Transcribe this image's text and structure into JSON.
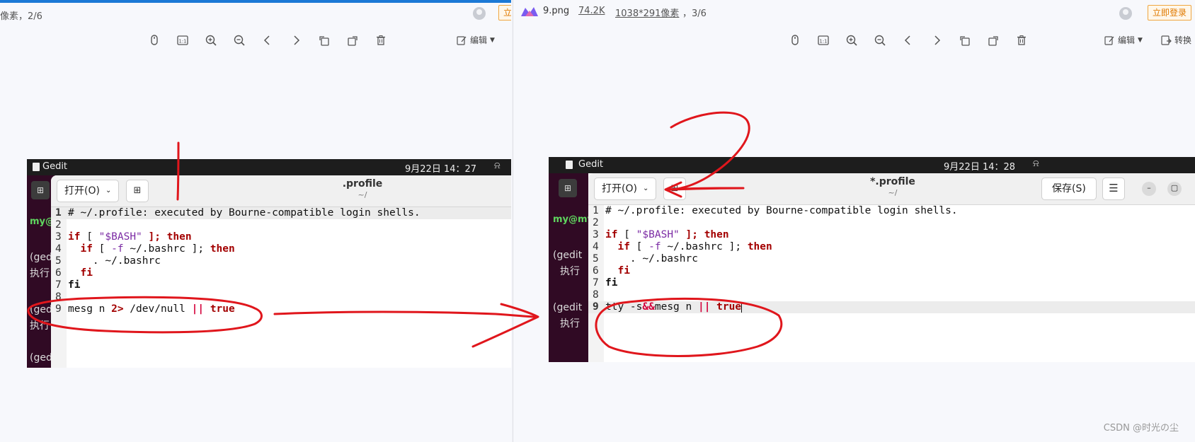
{
  "left_viewer": {
    "header_partial": "像素，2/6",
    "login_partial": "立",
    "edit_label": "编辑"
  },
  "right_viewer": {
    "file_name": "9.png",
    "file_size": "74.2K",
    "file_dimensions": "1038*291像素",
    "file_counter": "，3/6",
    "login_label": "立即登录",
    "edit_label": "编辑",
    "convert_label": "转换"
  },
  "toolbar_icons": [
    "mouse-icon",
    "actual-size-icon",
    "zoom-in-icon",
    "zoom-out-icon",
    "prev-icon",
    "next-icon",
    "rotate-left-icon",
    "rotate-right-icon",
    "delete-icon"
  ],
  "left_shot": {
    "app_name": "Gedit",
    "datetime": "9月22日 14：27",
    "open_label": "打开(O)",
    "doc_title": ".profile",
    "doc_path": "~/",
    "term_lines": [
      "my@my-",
      "(gedit",
      "执行",
      "(gedit",
      "执行",
      "(gedit"
    ],
    "line_numbers": [
      "1",
      "2",
      "3",
      "4",
      "5",
      "6",
      "7",
      "8",
      "9"
    ],
    "code": {
      "l1": "# ~/.profile: executed by Bourne-compatible login shells.",
      "l3_kw1": "if",
      "l3_a": " [ ",
      "l3_str": "\"$BASH\"",
      "l3_b": " ]; ",
      "l3_kw2": "then",
      "l4_kw1": "if",
      "l4_a": " [ ",
      "l4_flag": "-f",
      "l4_b": " ~/.bashrc ]; ",
      "l4_kw2": "then",
      "l5": "    . ~/.bashrc",
      "l6_kw": "fi",
      "l7_kw": "fi",
      "l9_a": "mesg n ",
      "l9_redir": "2>",
      "l9_b": " /dev/null ",
      "l9_or": "||",
      "l9_c": " ",
      "l9_kw": "true"
    }
  },
  "right_shot": {
    "app_name": "Gedit",
    "datetime": "9月22日 14：28",
    "open_label": "打开(O)",
    "doc_title": "*.profile",
    "doc_path": "~/",
    "save_label": "保存(S)",
    "term_lines": [
      "my@my-",
      "(gedit",
      "执行",
      "(gedit",
      "执行"
    ],
    "line_numbers": [
      "1",
      "2",
      "3",
      "4",
      "5",
      "6",
      "7",
      "8",
      "9"
    ],
    "code": {
      "l1": "# ~/.profile: executed by Bourne-compatible login shells.",
      "l3_kw1": "if",
      "l3_a": " [ ",
      "l3_str": "\"$BASH\"",
      "l3_b": " ]; ",
      "l3_kw2": "then",
      "l4_kw1": "if",
      "l4_a": " [ ",
      "l4_flag": "-f",
      "l4_b": " ~/.bashrc ]; ",
      "l4_kw2": "then",
      "l5": "    . ~/.bashrc",
      "l6_kw": "fi",
      "l7_kw": "fi",
      "l9_a": "tty -s",
      "l9_and": "&&",
      "l9_b": "mesg n ",
      "l9_or": "||",
      "l9_c": " ",
      "l9_kw": "true"
    }
  },
  "watermark": "CSDN @时光の尘",
  "colors": {
    "annotation": "#e0161c",
    "accent": "#1c79d6",
    "login": "#e07a00"
  }
}
